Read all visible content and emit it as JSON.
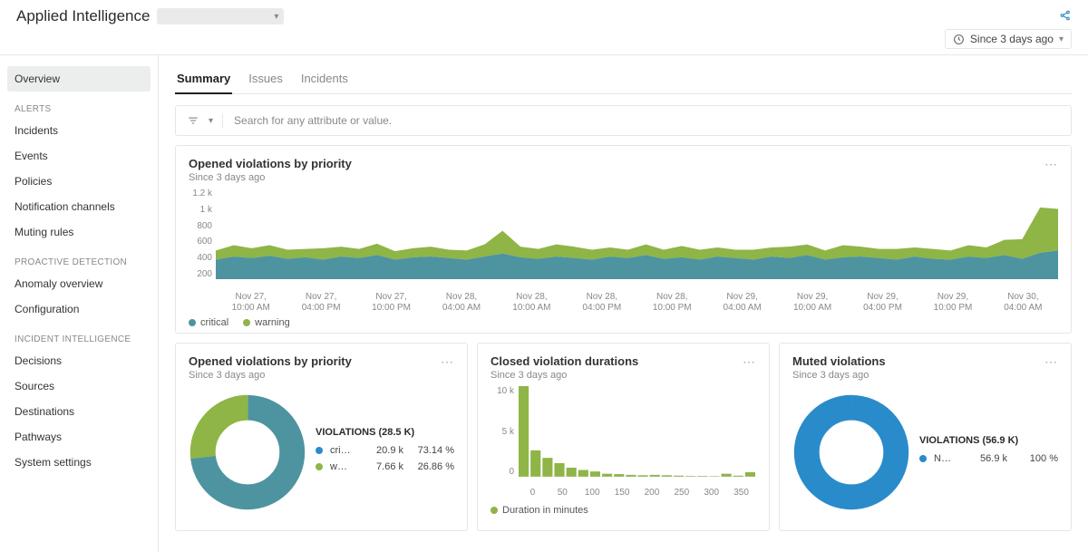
{
  "header": {
    "title": "Applied Intelligence",
    "time_filter_label": "Since 3 days ago"
  },
  "sidebar": {
    "items": [
      {
        "label": "Overview",
        "active": true
      },
      {
        "group": "ALERTS"
      },
      {
        "label": "Incidents"
      },
      {
        "label": "Events"
      },
      {
        "label": "Policies"
      },
      {
        "label": "Notification channels"
      },
      {
        "label": "Muting rules"
      },
      {
        "group": "PROACTIVE DETECTION"
      },
      {
        "label": "Anomaly overview"
      },
      {
        "label": "Configuration"
      },
      {
        "group": "INCIDENT INTELLIGENCE"
      },
      {
        "label": "Decisions"
      },
      {
        "label": "Sources"
      },
      {
        "label": "Destinations"
      },
      {
        "label": "Pathways"
      },
      {
        "label": "System settings"
      }
    ]
  },
  "tabs": [
    {
      "label": "Summary",
      "active": true
    },
    {
      "label": "Issues"
    },
    {
      "label": "Incidents"
    }
  ],
  "search": {
    "placeholder": "Search for any attribute or value."
  },
  "card_area": {
    "title": "Opened violations by priority",
    "subtitle": "Since 3 days ago",
    "legend": [
      {
        "name": "critical",
        "color": "#4e94a0"
      },
      {
        "name": "warning",
        "color": "#8eb546"
      }
    ]
  },
  "card_donut1": {
    "title": "Opened violations by priority",
    "subtitle": "Since 3 days ago",
    "heading": "VIOLATIONS (28.5 K)",
    "rows": [
      {
        "dot": "#2a8bcb",
        "label": "cri…",
        "value": "20.9 k",
        "pct": "73.14 %"
      },
      {
        "dot": "#8eb546",
        "label": "w…",
        "value": "7.66 k",
        "pct": "26.86 %"
      }
    ]
  },
  "card_hist": {
    "title": "Closed violation durations",
    "subtitle": "Since 3 days ago",
    "legend": [
      {
        "name": "Duration in minutes",
        "color": "#8eb546"
      }
    ]
  },
  "card_donut2": {
    "title": "Muted violations",
    "subtitle": "Since 3 days ago",
    "heading": "VIOLATIONS (56.9 K)",
    "rows": [
      {
        "dot": "#2a8bcb",
        "label": "N…",
        "value": "56.9 k",
        "pct": "100 %"
      }
    ]
  },
  "chart_data": [
    {
      "id": "opened_violations_area",
      "type": "area",
      "title": "Opened violations by priority",
      "ylabel": "",
      "y_ticks": [
        "1.2 k",
        "1 k",
        "800",
        "600",
        "400",
        "200"
      ],
      "ylim": [
        0,
        1200
      ],
      "x_categories": [
        "Nov 27, 10:00 AM",
        "Nov 27, 04:00 PM",
        "Nov 27, 10:00 PM",
        "Nov 28, 04:00 AM",
        "Nov 28, 10:00 AM",
        "Nov 28, 04:00 PM",
        "Nov 28, 10:00 PM",
        "Nov 29, 04:00 AM",
        "Nov 29, 10:00 AM",
        "Nov 29, 04:00 PM",
        "Nov 29, 10:00 PM",
        "Nov 30, 04:00 AM"
      ],
      "series": [
        {
          "name": "critical",
          "color": "#4e94a0",
          "values": [
            260,
            300,
            280,
            310,
            270,
            290,
            260,
            300,
            280,
            320,
            260,
            290,
            300,
            280,
            260,
            300,
            340,
            290,
            270,
            300,
            280,
            260,
            300,
            280,
            320,
            270,
            290,
            260,
            300,
            280,
            260,
            300,
            280,
            320,
            260,
            290,
            300,
            280,
            260,
            300,
            270,
            260,
            300,
            280,
            320,
            270,
            350,
            380
          ]
        },
        {
          "name": "warning",
          "color": "#8eb546",
          "values": [
            120,
            150,
            130,
            140,
            120,
            110,
            150,
            130,
            120,
            150,
            110,
            120,
            130,
            110,
            120,
            160,
            300,
            140,
            130,
            160,
            150,
            130,
            120,
            110,
            140,
            120,
            150,
            130,
            120,
            110,
            130,
            120,
            150,
            140,
            120,
            160,
            130,
            120,
            140,
            120,
            130,
            120,
            150,
            140,
            200,
            260,
            600,
            550
          ]
        }
      ]
    },
    {
      "id": "opened_violations_donut",
      "type": "pie",
      "title": "Opened violations by priority",
      "total_label": "VIOLATIONS (28.5 K)",
      "series": [
        {
          "name": "critical",
          "value": 20900,
          "pct": 73.14,
          "color": "#4e94a0"
        },
        {
          "name": "warning",
          "value": 7660,
          "pct": 26.86,
          "color": "#8eb546"
        }
      ]
    },
    {
      "id": "closed_violation_durations",
      "type": "bar",
      "title": "Closed violation durations",
      "xlabel": "Duration in minutes",
      "x_ticks": [
        "0",
        "50",
        "100",
        "150",
        "200",
        "250",
        "300",
        "350"
      ],
      "y_ticks": [
        "10 k",
        "5 k",
        "0"
      ],
      "ylim": [
        0,
        12000
      ],
      "categories": [
        5,
        10,
        15,
        20,
        25,
        30,
        35,
        50,
        75,
        100,
        125,
        150,
        175,
        200,
        225,
        250,
        275,
        300,
        325,
        350
      ],
      "values": [
        12000,
        3500,
        2500,
        1800,
        1200,
        900,
        700,
        400,
        350,
        250,
        200,
        250,
        200,
        150,
        100,
        100,
        80,
        400,
        150,
        600
      ]
    },
    {
      "id": "muted_violations_donut",
      "type": "pie",
      "title": "Muted violations",
      "total_label": "VIOLATIONS (56.9 K)",
      "series": [
        {
          "name": "N",
          "value": 56900,
          "pct": 100,
          "color": "#2a8bcb"
        }
      ]
    }
  ]
}
